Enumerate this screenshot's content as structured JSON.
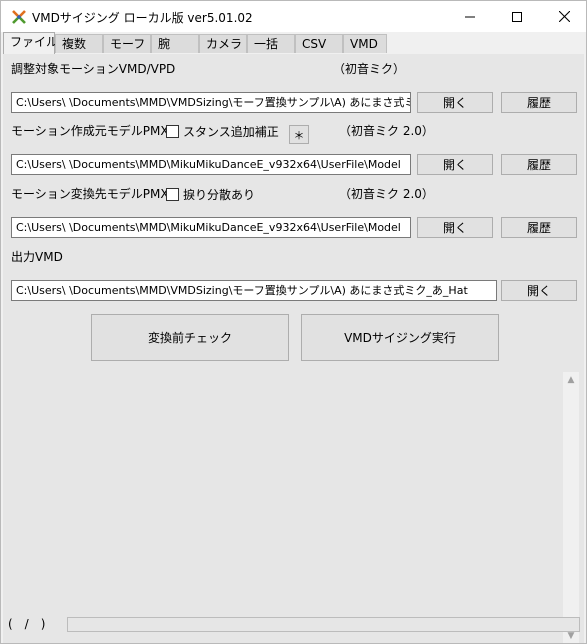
{
  "window": {
    "title": "VMDサイジング ローカル版 ver5.01.02",
    "icon": "app-logo-icon"
  },
  "tabs": [
    {
      "label": "ファイル",
      "active": true
    },
    {
      "label": "複数",
      "active": false
    },
    {
      "label": "モーフ",
      "active": false
    },
    {
      "label": "腕",
      "active": false
    },
    {
      "label": "カメラ",
      "active": false
    },
    {
      "label": "一括",
      "active": false
    },
    {
      "label": "CSV",
      "active": false
    },
    {
      "label": "VMD",
      "active": false
    }
  ],
  "motion_section": {
    "label": "調整対象モーションVMD/VPD",
    "model_name": "（初音ミク）",
    "path_value": "C:\\Users\\          \\Documents\\MMD\\VMDSizing\\モーフ置換サンプル\\A) あにまさ式ミク_あ_Hat",
    "open_label": "開く",
    "history_label": "履歴"
  },
  "source_section": {
    "label": "モーション作成元モデルPMX",
    "checkbox_label": "スタンス追加補正",
    "checkbox_checked": false,
    "star_label": "＊",
    "model_name": "（初音ミク 2.0）",
    "path_value": "C:\\Users\\          \\Documents\\MMD\\MikuMikuDanceE_v932x64\\UserFile\\Model",
    "open_label": "開く",
    "history_label": "履歴"
  },
  "target_section": {
    "label": "モーション変換先モデルPMX",
    "checkbox_label": "捩り分散あり",
    "checkbox_checked": false,
    "model_name": "（初音ミク 2.0）",
    "path_value": "C:\\Users\\          \\Documents\\MMD\\MikuMikuDanceE_v932x64\\UserFile\\Model",
    "open_label": "開く",
    "history_label": "履歴"
  },
  "output_section": {
    "label": "出力VMD",
    "path_value": "C:\\Users\\          \\Documents\\MMD\\VMDSizing\\モーフ置換サンプル\\A) あにまさ式ミク_あ_Hat",
    "open_label": "開く"
  },
  "actions": {
    "check_label": "変換前チェック",
    "run_label": "VMDサイジング実行"
  },
  "status": {
    "counter": "(　/　)",
    "progress": 0
  },
  "colors": {
    "panel": "#e6e6e6",
    "progress": "#06b025"
  }
}
